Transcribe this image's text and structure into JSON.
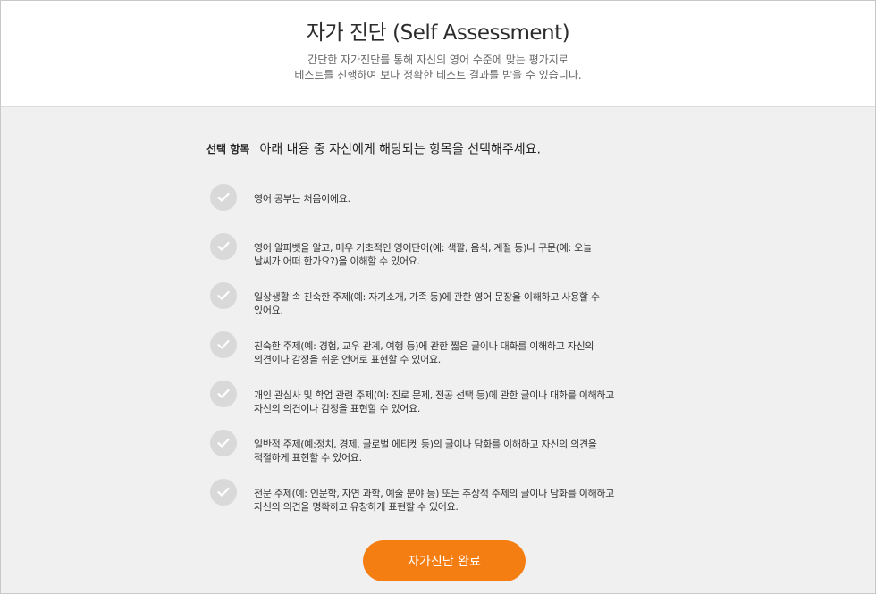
{
  "header": {
    "title": "자가 진단 (Self Assessment)",
    "subtitle_line1": "간단한 자가진단를 통해 자신의 영어 수준에 맞는 평가지로",
    "subtitle_line2": "테스트를 진행하여 보다 정확한 테스트 결과를 받을 수 있습니다."
  },
  "prompt": {
    "label": "선택 항목",
    "text": "아래 내용 중 자신에게 해당되는 항목을 선택해주세요."
  },
  "options": [
    {
      "lines": [
        "영어 공부는 처음이에요."
      ],
      "checked": false
    },
    {
      "lines": [
        "영어 알파벳을 알고, 매우 기초적인 영어단어(예: 색깔, 음식, 계절 등)나 구문(예: 오늘",
        "날씨가 어떠 한가요?)을 이해할 수 있어요."
      ],
      "checked": false
    },
    {
      "lines": [
        "일상생활 속 친숙한 주제(예: 자기소개, 가족 등)에 관한 영어 문장을 이해하고 사용할 수",
        "있어요."
      ],
      "checked": false
    },
    {
      "lines": [
        "친숙한 주제(예: 경험, 교우 관계, 여행 등)에 관한 짧은 글이나 대화를 이해하고 자신의",
        "의견이나 감정을 쉬운 언어로 표현할 수 있어요."
      ],
      "checked": false
    },
    {
      "lines": [
        "개인 관심사 및 학업 관련 주제(예: 진로 문제, 전공 선택 등)에 관한 글이나 대화를 이해하고",
        "자신의 의견이나 감정을 표현할 수 있어요."
      ],
      "checked": false
    },
    {
      "lines": [
        "일반적 주제(예:정치, 경제, 글로벌 에티켓 등)의 글이나 담화를 이해하고 자신의 의견을",
        "적절하게 표현할 수 있어요."
      ],
      "checked": false
    },
    {
      "lines": [
        "전문 주제(예: 인문학, 자연 과학, 예술 분야 등) 또는 추상적 주제의 글이나 담화를 이해하고",
        "자신의 의견을 명확하고 유창하게 표현할 수 있어요."
      ],
      "checked": false
    }
  ],
  "submit_label": "자가진단 완료",
  "colors": {
    "accent": "#f57e13",
    "check_bg": "#d9d9d9",
    "page_bg": "#f0f0f0"
  },
  "icons": {
    "option_check": "check-icon"
  }
}
